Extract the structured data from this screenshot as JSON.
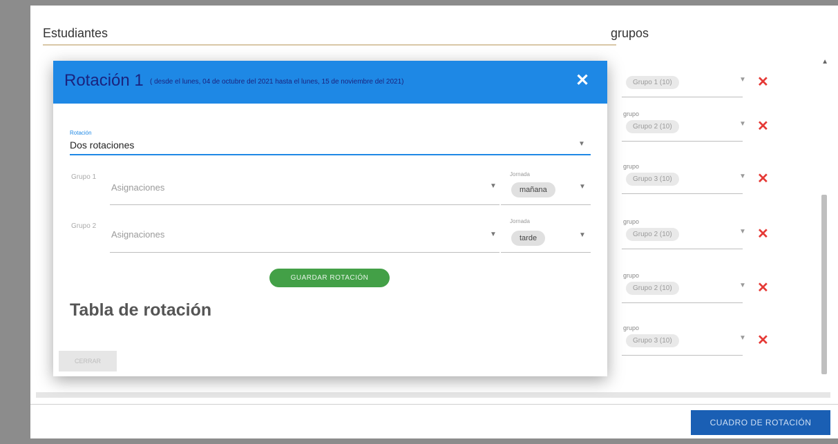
{
  "background": {
    "students_title": "Estudiantes",
    "groups_title": "grupos",
    "group_rows": [
      {
        "label": "",
        "value": "Grupo 1 (10)"
      },
      {
        "label": "grupo",
        "value": "Grupo 2 (10)"
      },
      {
        "label": "grupo",
        "value": "Grupo 3 (10)"
      },
      {
        "label": "grupo",
        "value": "Grupo 2 (10)"
      },
      {
        "label": "grupo",
        "value": "Grupo 2 (10)"
      },
      {
        "label": "grupo",
        "value": "Grupo 3 (10)"
      }
    ],
    "cuadro_button": "CUADRO DE ROTACIÓN"
  },
  "modal": {
    "title": "Rotación 1",
    "subtitle": "( desde el lunes, 04 de octubre del 2021 hasta el lunes, 15 de noviembre del 2021)",
    "rotation_label": "Rotación",
    "rotation_value": "Dos rotaciones",
    "groups": [
      {
        "label": "Grupo 1",
        "placeholder": "Asignaciones",
        "jornada_label": "Jornada",
        "jornada": "mañana"
      },
      {
        "label": "Grupo 2",
        "placeholder": "Asignaciones",
        "jornada_label": "Jornada",
        "jornada": "tarde"
      }
    ],
    "save_button": "GUARDAR ROTACIÓN",
    "table_heading": "Tabla de rotación",
    "close_button": "CERRAR"
  },
  "icons": {
    "close": "close-icon",
    "caret": "chevron-down-icon",
    "remove": "remove-icon"
  },
  "colors": {
    "header": "#1e88e5",
    "save": "#43a047",
    "remove": "#e53935",
    "primary_button": "#1a5fb4"
  }
}
